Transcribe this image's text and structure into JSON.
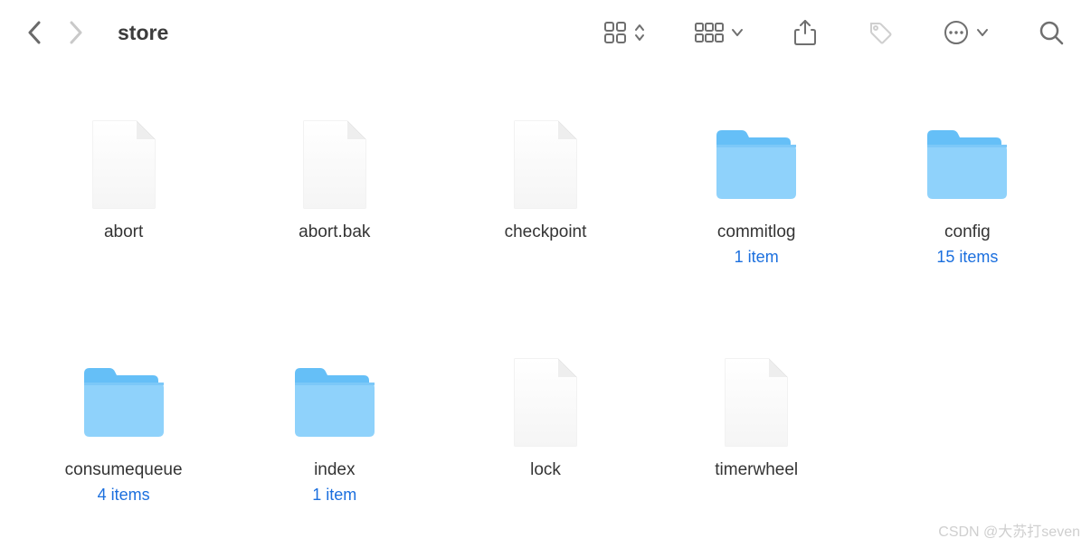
{
  "header": {
    "title": "store"
  },
  "items": [
    {
      "name": "abort",
      "type": "file",
      "meta": ""
    },
    {
      "name": "abort.bak",
      "type": "file",
      "meta": ""
    },
    {
      "name": "checkpoint",
      "type": "file",
      "meta": ""
    },
    {
      "name": "commitlog",
      "type": "folder",
      "meta": "1 item"
    },
    {
      "name": "config",
      "type": "folder",
      "meta": "15 items"
    },
    {
      "name": "consumequeue",
      "type": "folder",
      "meta": "4 items"
    },
    {
      "name": "index",
      "type": "folder",
      "meta": "1 item"
    },
    {
      "name": "lock",
      "type": "file",
      "meta": ""
    },
    {
      "name": "timerwheel",
      "type": "file",
      "meta": ""
    }
  ],
  "watermark": "CSDN @大苏打seven"
}
